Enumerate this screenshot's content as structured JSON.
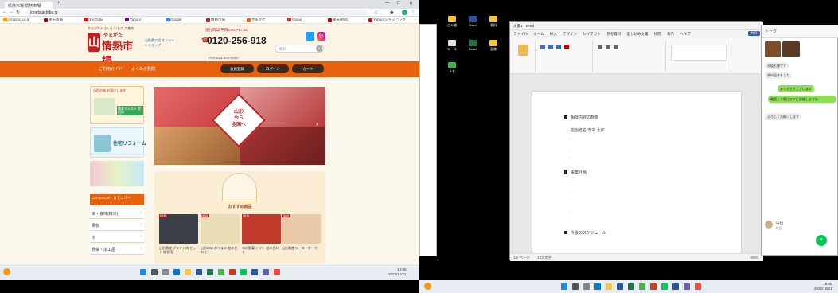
{
  "browser": {
    "tab_title": "情熱市場 情熱市場",
    "new_tab": "+",
    "url": "jonetsuichiba.jp",
    "window_controls": [
      "—",
      "□",
      "✕"
    ],
    "bookmarks": [
      {
        "label": "Amazon.co.jp",
        "color": "#f90"
      },
      {
        "label": "楽天市場",
        "color": "#bf0000"
      },
      {
        "label": "YouTube",
        "color": "#f00"
      },
      {
        "label": "Yahoo!",
        "color": "#7b0099"
      },
      {
        "label": "Google",
        "color": "#4285f4"
      },
      {
        "label": "情熱市場",
        "color": "#c01f1f"
      },
      {
        "label": "やまがた",
        "color": "#e8610c"
      },
      {
        "label": "Gmail",
        "color": "#d93025"
      },
      {
        "label": "楽天RMS",
        "color": "#bf0000"
      },
      {
        "label": "Yahoo!ショッピング",
        "color": "#f00"
      }
    ]
  },
  "site": {
    "tagline": "やまがたの おいしいもの 大集合",
    "logo_top": "やまがた",
    "logo_name": "情熱市場",
    "logo_mark": "山",
    "yamagata_badge": "山形県公認 オンラインショップ",
    "hours": "受付時間 平日9:00〜17:00",
    "phone": "0120-256-918",
    "fax": "FAX 023-000-0000",
    "search_placeholder": "検索",
    "sns": {
      "twitter": "t",
      "instagram": "◎"
    },
    "nav": {
      "links": [
        "ご利用ガイド",
        "よくある質問"
      ],
      "buttons": [
        "会員登録",
        "ログイン",
        "カート"
      ]
    },
    "sidebar": {
      "banner1_label": "山形の味 お届けします",
      "banner1_caption": "農業アシスト 受付中",
      "banner2_caption": "住宅リフォーム",
      "category_header": "CATEGORY カテゴリー",
      "categories": [
        "米・食味(精米)",
        "果物",
        "肉",
        "野菜・加工品"
      ]
    },
    "hero": {
      "text_line1": "山形",
      "text_line2": "やら",
      "text_line3": "全国へ",
      "arrow": "›"
    },
    "recommend": {
      "title": "おすすめ商品",
      "badge": "NEW",
      "products": [
        "山形県産 ブランド肉 セット 贈答用",
        "山形の味 おつまみ 詰め合わせ",
        "旬の野菜 トマト 詰め合わせ",
        "山形県産 ローストポーク"
      ]
    }
  },
  "taskbar_left": {
    "time": "18:05",
    "date": "2022/10/21"
  },
  "desktop": {
    "icons": [
      "ごみ箱",
      "Word",
      "資料",
      "ツール",
      "Excel",
      "画像",
      "メモ"
    ]
  },
  "word": {
    "title": "文書1 - Word",
    "menu": [
      "ファイル",
      "ホーム",
      "挿入",
      "デザイン",
      "レイアウト",
      "参考資料",
      "差し込み文書",
      "校閲",
      "表示",
      "ヘルプ"
    ],
    "share": "共有",
    "headings": [
      "相談内容の概要",
      "事業計画",
      "今後のスケジュール"
    ],
    "sub_line": "担当者名 田中 太郎",
    "status_left": "1/2 ページ",
    "status_words": "123 文字",
    "zoom": "100%"
  },
  "chat": {
    "header": "トーク",
    "messages": [
      {
        "dir": "in",
        "text": "お疲れ様です"
      },
      {
        "dir": "in",
        "text": "資料届きました"
      },
      {
        "dir": "out",
        "text": "ありがとうございます"
      },
      {
        "dir": "out",
        "text": "確認して明日までに連絡しますね"
      },
      {
        "dir": "in",
        "text": "よろしくお願いします"
      }
    ],
    "contact_name": "山田",
    "contact_sub": "既読",
    "fab": "+"
  },
  "taskbar_right": {
    "time": "18:05",
    "date": "2022/10/21"
  }
}
